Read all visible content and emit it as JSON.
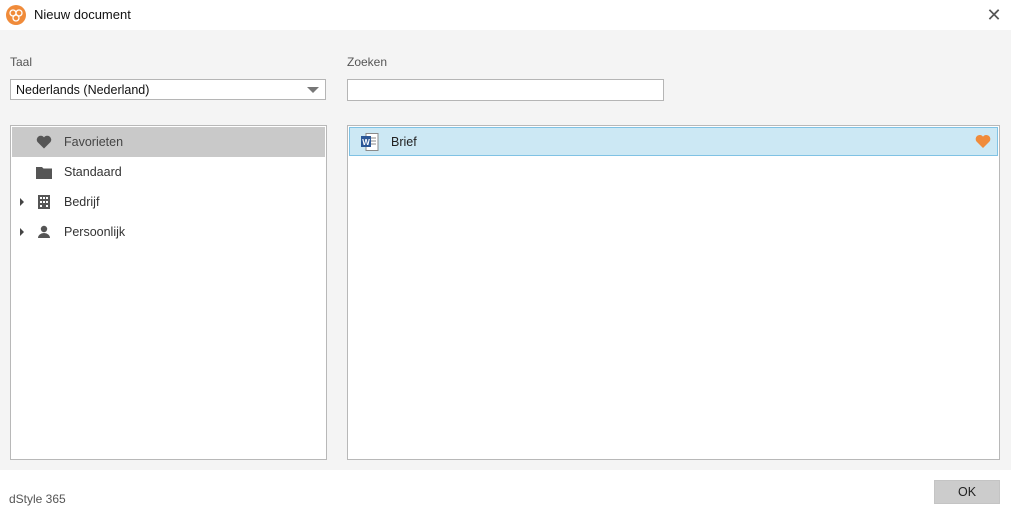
{
  "window": {
    "title": "Nieuw document",
    "close_symbol": "✕"
  },
  "language": {
    "label": "Taal",
    "selected": "Nederlands (Nederland)"
  },
  "search": {
    "label": "Zoeken",
    "value": "",
    "placeholder": ""
  },
  "tree": {
    "items": [
      {
        "label": "Favorieten",
        "icon": "heart-icon",
        "selected": true,
        "expandable": false
      },
      {
        "label": "Standaard",
        "icon": "folder-icon",
        "selected": false,
        "expandable": false
      },
      {
        "label": "Bedrijf",
        "icon": "building-icon",
        "selected": false,
        "expandable": true
      },
      {
        "label": "Persoonlijk",
        "icon": "person-icon",
        "selected": false,
        "expandable": true
      }
    ]
  },
  "documents": {
    "items": [
      {
        "label": "Brief",
        "icon": "word-document-icon",
        "favorite": true,
        "selected": true
      }
    ]
  },
  "footer": {
    "brand": "dStyle 365",
    "ok_label": "OK"
  },
  "colors": {
    "accent": "#f08b3a",
    "selection_blue": "#cce8f4",
    "selection_border": "#7fc2e4",
    "tree_selection": "#c9c9c9",
    "favorite_heart": "#f08b3a"
  }
}
